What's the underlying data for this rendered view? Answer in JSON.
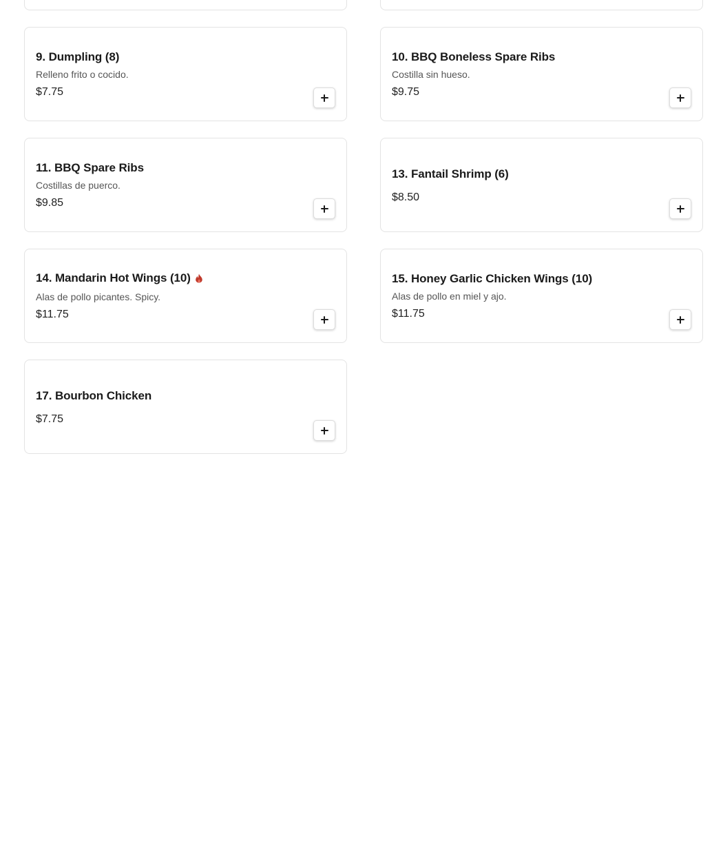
{
  "colors": {
    "spicy": "#c0392b",
    "border": "#e3e3e3",
    "text": "#1a1a1a",
    "muted": "#555555"
  },
  "menu": {
    "add_button_icon": "plus-icon",
    "items": [
      {
        "title": "9. Dumpling (8)",
        "description": "Relleno frito o cocido.",
        "price": "$7.75",
        "spicy": false
      },
      {
        "title": "10. BBQ Boneless Spare Ribs",
        "description": "Costilla sin hueso.",
        "price": "$9.75",
        "spicy": false
      },
      {
        "title": "11. BBQ Spare Ribs",
        "description": "Costillas de puerco.",
        "price": "$9.85",
        "spicy": false
      },
      {
        "title": "13. Fantail Shrimp (6)",
        "description": "",
        "price": "$8.50",
        "spicy": false
      },
      {
        "title": "14. Mandarin Hot Wings (10)",
        "description": "Alas de pollo picantes. Spicy.",
        "price": "$11.75",
        "spicy": true,
        "badge_icon": "flame-icon"
      },
      {
        "title": "15. Honey Garlic Chicken Wings (10)",
        "description": "Alas de pollo en miel y ajo.",
        "price": "$11.75",
        "spicy": false
      },
      {
        "title": "17. Bourbon Chicken",
        "description": "",
        "price": "$7.75",
        "spicy": false
      }
    ]
  }
}
